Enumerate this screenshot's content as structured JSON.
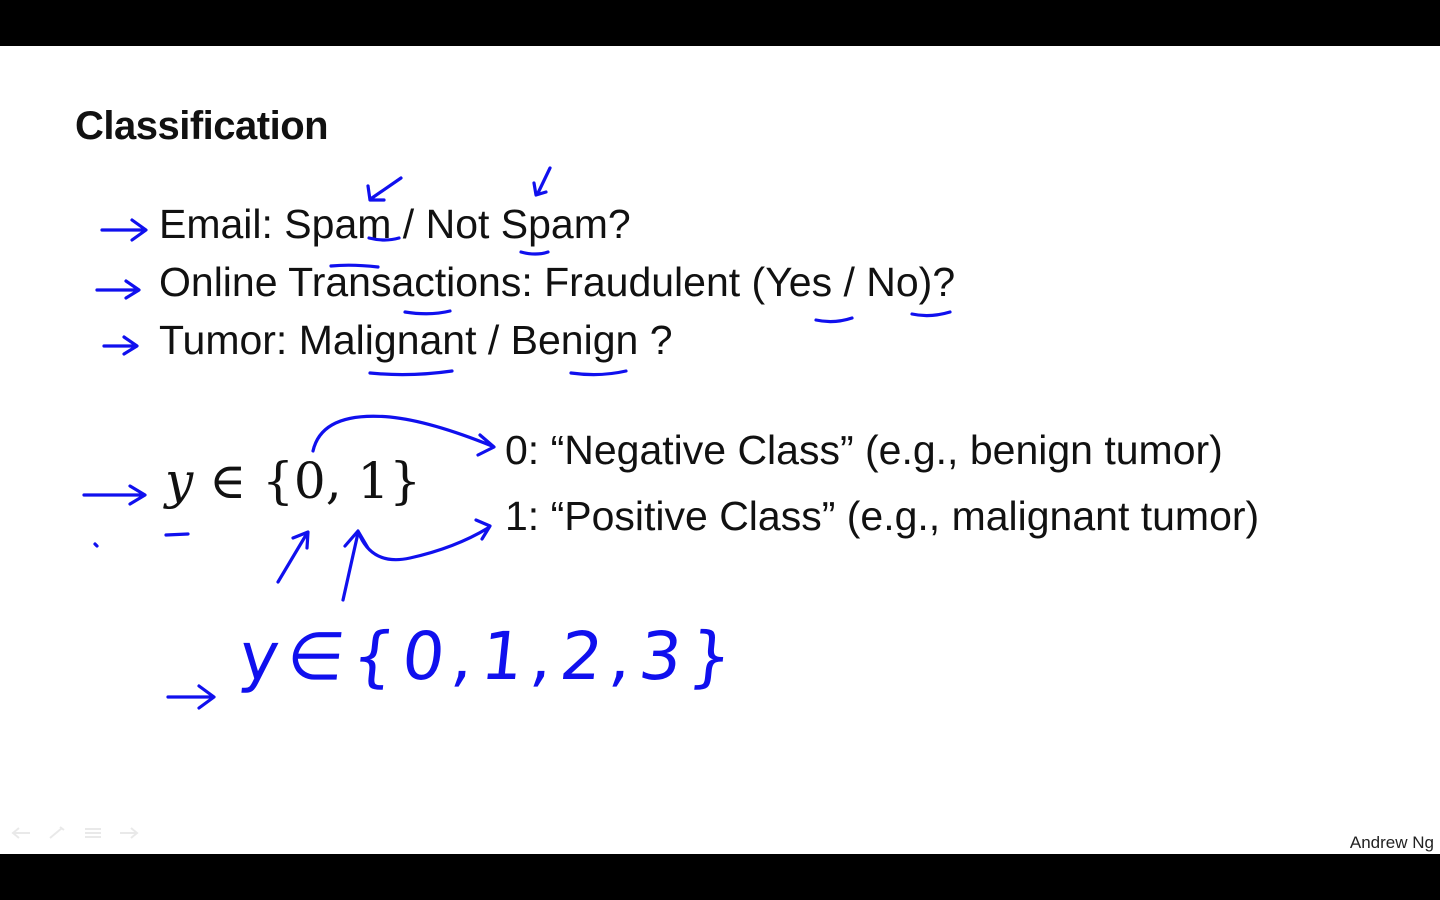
{
  "slide": {
    "title": "Classification",
    "bullets": [
      "Email: Spam / Not Spam?",
      "Online Transactions: Fraudulent (Yes / No)?",
      "Tumor: Malignant / Benign ?"
    ],
    "set_notation": {
      "variable": "y",
      "symbol": "∈",
      "set": "{0, 1}"
    },
    "classes": [
      "0: “Negative Class” (e.g., benign tumor)",
      "1: “Positive Class” (e.g., malignant tumor)"
    ],
    "handwritten_note": "y∈{0,1,2,3}",
    "author": "Andrew Ng",
    "ink_color": "#1010ee"
  },
  "controls": {
    "icons": [
      "back-icon",
      "pen-icon",
      "menu-icon",
      "forward-icon"
    ]
  }
}
